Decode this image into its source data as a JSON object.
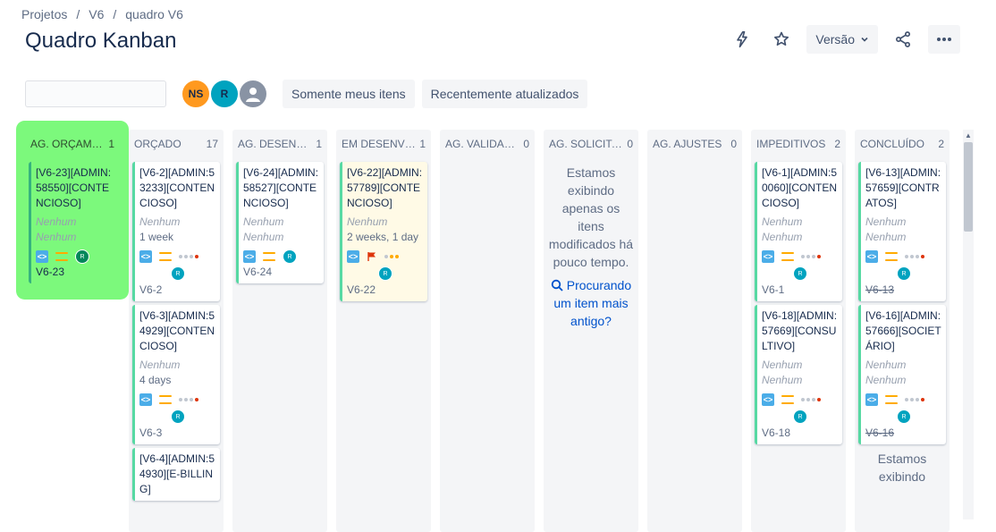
{
  "breadcrumb": [
    "Projetos",
    "V6",
    "quadro V6"
  ],
  "page_title": "Quadro Kanban",
  "actions": {
    "version_label": "Versão"
  },
  "search": {
    "placeholder": ""
  },
  "avatars": [
    "NS",
    "R"
  ],
  "filters": [
    "Somente meus itens",
    "Recentemente atualizados"
  ],
  "columns": [
    {
      "name": "AG. ORÇAMENTO",
      "count": "1",
      "cards": [
        {
          "title": "[V6-23][ADMIN:58550][CONTENCIOSO]",
          "meta1": "Nenhum",
          "meta2": "Nenhum",
          "key": "V6-23",
          "done": false
        }
      ]
    },
    {
      "name": "ORÇADO",
      "count": "17",
      "cards": [
        {
          "title": "[V6-2][ADMIN:53233][CONTENCIOSO]",
          "meta1": "Nenhum",
          "est": "1 week",
          "key": "V6-2"
        },
        {
          "title": "[V6-3][ADMIN:54929][CONTENCIOSO]",
          "meta1": "Nenhum",
          "est": "4 days",
          "key": "V6-3"
        },
        {
          "title": "[V6-4][ADMIN:54930][E-BILLING]"
        }
      ]
    },
    {
      "name": "AG. DESENVOLVIMENTO",
      "count": "1",
      "cards": [
        {
          "title": "[V6-24][ADMIN:58527][CONTENCIOSO]",
          "meta1": "Nenhum",
          "meta2": "Nenhum",
          "key": "V6-24"
        }
      ]
    },
    {
      "name": "EM DESENVOLVIMENTO",
      "count": "1",
      "cards": [
        {
          "title": "[V6-22][ADMIN:57789][CONTENCIOSO]",
          "meta1": "Nenhum",
          "est": "2 weeks, 1 day",
          "key": "V6-22"
        }
      ]
    },
    {
      "name": "AG. VALIDAÇÃO",
      "count": "0"
    },
    {
      "name": "AG. SOLICITANTE",
      "count": "0",
      "empty_text": "Estamos exibindo apenas os itens modificados há pouco tempo.",
      "empty_link": "Procurando um item mais antigo?"
    },
    {
      "name": "AG. AJUSTES",
      "count": "0"
    },
    {
      "name": "IMPEDITIVOS",
      "count": "2",
      "cards": [
        {
          "title": "[V6-1][ADMIN:50060][CONTENCIOSO]",
          "meta1": "Nenhum",
          "meta2": "Nenhum",
          "key": "V6-1"
        },
        {
          "title": "[V6-18][ADMIN:57669][CONSULTIVO]",
          "meta1": "Nenhum",
          "meta2": "Nenhum",
          "key": "V6-18"
        }
      ]
    },
    {
      "name": "CONCLUÍDO",
      "count": "2",
      "cards": [
        {
          "title": "[V6-13][ADMIN:57659][CONTRATOS]",
          "meta1": "Nenhum",
          "meta2": "Nenhum",
          "key": "V6-13"
        },
        {
          "title": "[V6-16][ADMIN:57666][SOCIETÁRIO]",
          "meta1": "Nenhum",
          "meta2": "Nenhum",
          "key": "V6-16"
        }
      ],
      "empty_text": "Estamos exibindo"
    }
  ],
  "icons": {
    "story": "story-icon",
    "priority": "priority-medium-icon",
    "flag": "flag-icon",
    "assignee": "R"
  },
  "colors": {
    "highlight": "#7cf97c",
    "card_accent": "#57d9a3",
    "link": "#0052cc",
    "flagged_card": "#fffae6"
  }
}
